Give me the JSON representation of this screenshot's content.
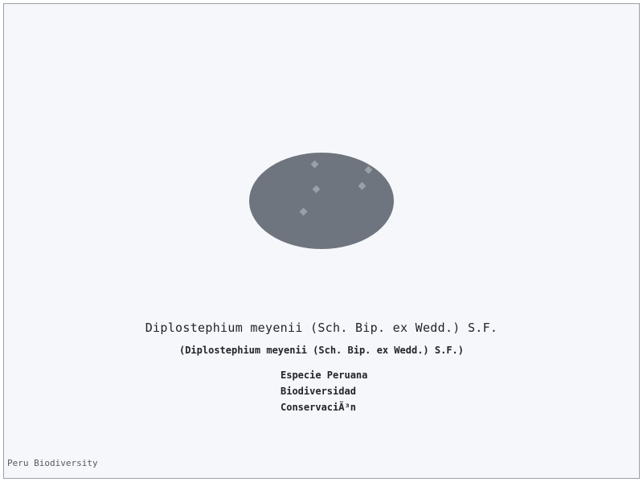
{
  "species": {
    "name": "Diplostephium meyenii (Sch. Bip. ex Wedd.) S.F.",
    "name_parenthetical": "(Diplostephium meyenii (Sch. Bip. ex Wedd.) S.F.)"
  },
  "tags": [
    "Especie Peruana",
    "Biodiversidad",
    "ConservaciÃ³n"
  ],
  "footer": {
    "label": "Peru Biodiversity"
  },
  "colors": {
    "oval": "#6e757f",
    "dots": "#9aa0a8",
    "background": "#f5f7fa",
    "text": "#222428"
  }
}
